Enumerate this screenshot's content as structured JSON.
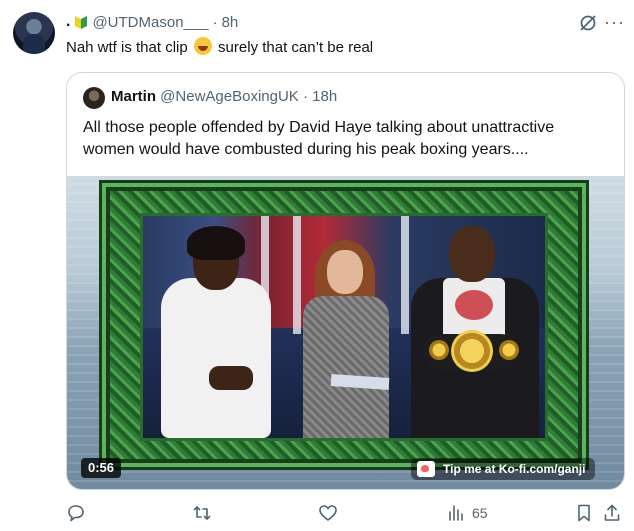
{
  "tweet": {
    "handle": "@UTDMason___",
    "dot": ".",
    "time": "8h",
    "separator": "·",
    "text_before_emoji": "Nah wtf is that clip ",
    "text_after_emoji": " surely that can’t be real",
    "emoji_icon": "rolling-on-floor-laughing-emoji"
  },
  "quoted": {
    "name": "Martin",
    "handle": "@NewAgeBoxingUK",
    "separator": "·",
    "time": "18h",
    "text": "All those people offended by David Haye talking about unattractive women would have combusted during his peak boxing years....",
    "media": {
      "duration": "0:56",
      "overlay": "Tip me at Ko-fi.com/ganji"
    }
  },
  "actions": {
    "reply_count": "",
    "retweet_count": "",
    "like_count": "",
    "views_count": "65"
  },
  "colors": {
    "text": "#0f1419",
    "secondary": "#536471",
    "border": "#cfd9de",
    "frame_green": "#2f7d36"
  }
}
